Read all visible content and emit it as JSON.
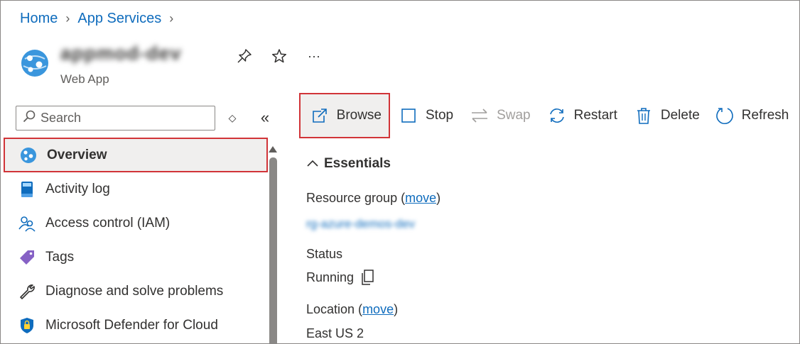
{
  "breadcrumb": [
    {
      "label": "Home"
    },
    {
      "label": "App Services"
    }
  ],
  "resource": {
    "name": "appmod-dev",
    "type": "Web App"
  },
  "header_actions": [
    "pin-icon",
    "star-icon",
    "more-icon"
  ],
  "header_more_label": "···",
  "search": {
    "placeholder": "Search"
  },
  "nav_tools": {
    "expand_label": "◇",
    "collapse_label": "«"
  },
  "nav": {
    "items": [
      {
        "label": "Overview",
        "icon": "app-service-icon",
        "active": true
      },
      {
        "label": "Activity log",
        "icon": "activity-log-icon"
      },
      {
        "label": "Access control (IAM)",
        "icon": "people-icon"
      },
      {
        "label": "Tags",
        "icon": "tag-icon"
      },
      {
        "label": "Diagnose and solve problems",
        "icon": "wrench-icon"
      },
      {
        "label": "Microsoft Defender for Cloud",
        "icon": "shield-icon"
      }
    ]
  },
  "toolbar": {
    "browse": "Browse",
    "stop": "Stop",
    "swap": "Swap",
    "restart": "Restart",
    "delete": "Delete",
    "refresh": "Refresh"
  },
  "essentials": {
    "heading": "Essentials",
    "resource_group_label": "Resource group (",
    "resource_group_move": "move",
    "resource_group_close": ")",
    "resource_group_value": "rg-azure-demos-dev",
    "status_label": "Status",
    "status_value": "Running",
    "location_label": "Location (",
    "location_move": "move",
    "location_close": ")",
    "location_value": "East US 2"
  },
  "colors": {
    "accent": "#0f6cbd",
    "highlight_border": "#d13438",
    "selected_bg": "#f0efee"
  }
}
